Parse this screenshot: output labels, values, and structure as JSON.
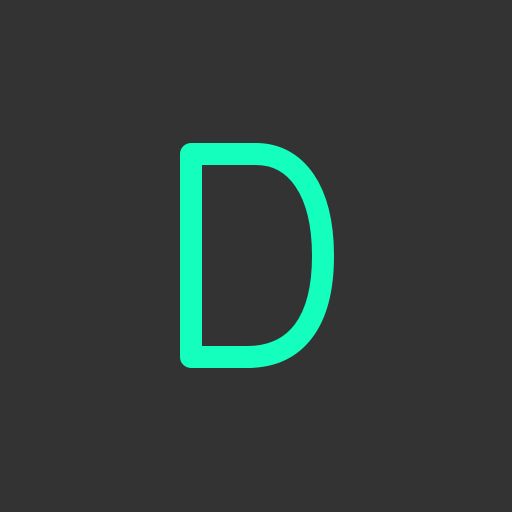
{
  "icon": {
    "letter": "D",
    "name": "letter-d-icon",
    "colors": {
      "background": "#333333",
      "glyph": "#14ffbd"
    }
  }
}
